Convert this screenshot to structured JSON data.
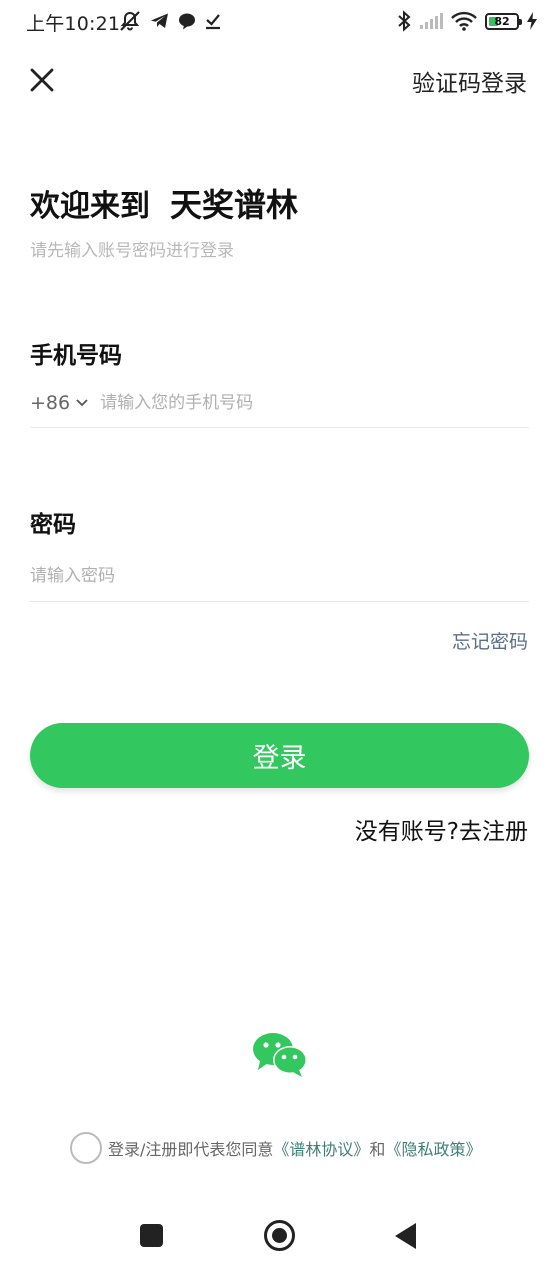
{
  "status_bar": {
    "time": "上午10:21",
    "battery": "82",
    "icons_left": [
      "mute-bell-icon",
      "telegram-icon",
      "chat-bubble-icon",
      "download-check-icon"
    ],
    "icons_right": [
      "bluetooth-icon",
      "signal-icon",
      "wifi-icon",
      "battery-icon",
      "charging-icon"
    ]
  },
  "header": {
    "close_icon": "close-icon",
    "sms_login_label": "验证码登录"
  },
  "welcome": {
    "prefix": "欢迎来到",
    "app_name": "天奖谱林",
    "subtitle": "请先输入账号密码进行登录"
  },
  "phone": {
    "label": "手机号码",
    "country_code": "+86",
    "placeholder": "请输入您的手机号码",
    "value": ""
  },
  "password": {
    "label": "密码",
    "placeholder": "请输入密码",
    "value": ""
  },
  "forgot_label": "忘记密码",
  "login_label": "登录",
  "register_label": "没有账号?去注册",
  "wechat_icon": "wechat-icon",
  "agreement": {
    "prefix": "登录/注册即代表您同意",
    "terms": "《谱林协议》",
    "conj": "和",
    "privacy": "《隐私政策》"
  },
  "colors": {
    "primary": "#33c75f",
    "link": "#3f7f74",
    "forgot": "#5a6f86",
    "placeholder": "#b0b0b0"
  }
}
